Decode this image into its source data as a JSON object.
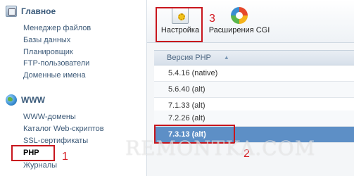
{
  "sidebar": {
    "main_section": {
      "title": "Главное",
      "items": [
        {
          "label": "Менеджер файлов"
        },
        {
          "label": "Базы данных"
        },
        {
          "label": "Планировщик"
        },
        {
          "label": "FTP-пользователи"
        },
        {
          "label": "Доменные имена"
        }
      ]
    },
    "www_section": {
      "title": "WWW",
      "items": [
        {
          "label": "WWW-домены"
        },
        {
          "label": "Каталог Web-скриптов"
        },
        {
          "label": "SSL-сертификаты"
        },
        {
          "label": "PHP"
        },
        {
          "label": "Журналы"
        }
      ]
    }
  },
  "toolbar": {
    "settings_label": "Настройка",
    "cgi_label": "Расширения CGI"
  },
  "table": {
    "column_header": "Версия PHP",
    "rows": [
      {
        "version": "5.4.16 (native)"
      },
      {
        "version": "5.6.40 (alt)"
      },
      {
        "version": "7.1.33 (alt)"
      },
      {
        "version": "7.2.26 (alt)"
      },
      {
        "version": "7.3.13 (alt)"
      }
    ]
  },
  "annotations": {
    "step1": "1",
    "step2": "2",
    "step3": "3",
    "color": "#d41920"
  },
  "watermark": "REMONTKA.COM",
  "icons": [
    "home-icon",
    "globe-icon",
    "settings-icon",
    "cgi-extensions-icon",
    "sort-ascending-icon"
  ]
}
